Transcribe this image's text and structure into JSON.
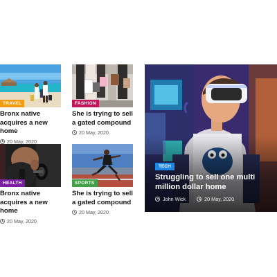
{
  "cards": [
    {
      "category": "TRAVEL",
      "category_color": "#f39c12",
      "title": "Bronx native acquires a new home",
      "date": "20 May, 2020",
      "image": "beach-travelers-image"
    },
    {
      "category": "FASHION",
      "category_color": "#c2185b",
      "title": "She is trying to sell a gated compound",
      "date": "20 May, 2020",
      "image": "shopping-bags-image"
    },
    {
      "category": "HEALTH",
      "category_color": "#7b1fa2",
      "title": "Bronx native acquires a new home",
      "date": "20 May, 2020",
      "image": "gym-dumbbell-image"
    },
    {
      "category": "SPORTS",
      "category_color": "#43a047",
      "title": "She is trying to sell a gated compound",
      "date": "20 May, 2020",
      "image": "runner-stadium-image"
    }
  ],
  "feature": {
    "category": "TECH",
    "category_color": "#1e88e5",
    "title": "Struggling to sell one multi million dollar home",
    "author": "John Wick",
    "date": "20 May, 2020",
    "image": "vr-headset-boy-image"
  }
}
